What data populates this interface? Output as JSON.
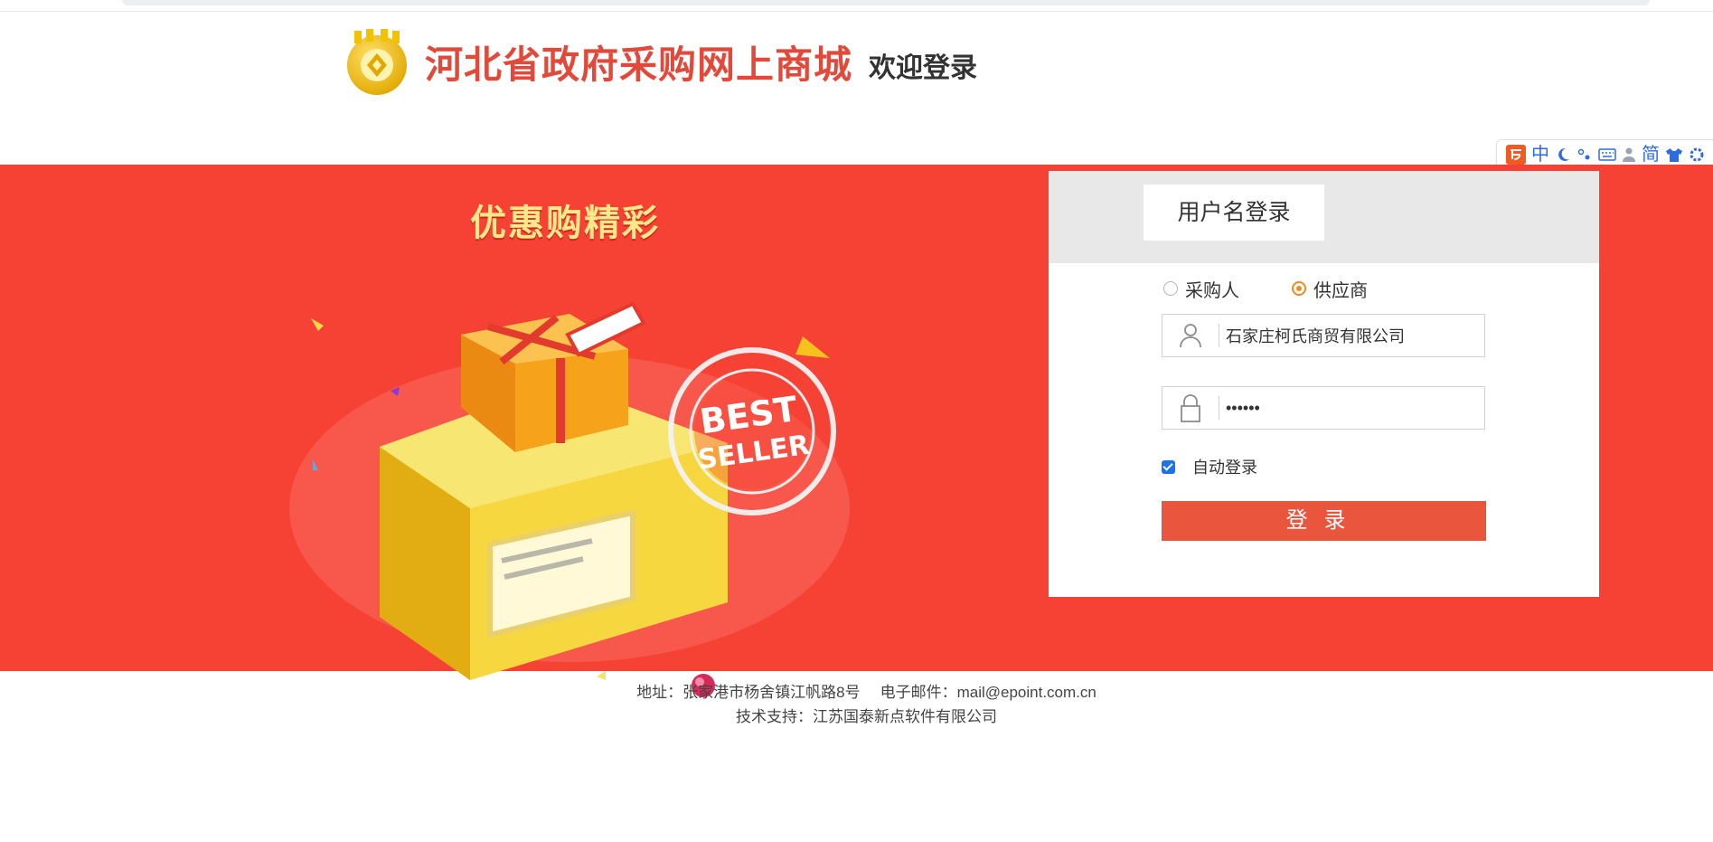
{
  "header": {
    "site_title": "河北省政府采购网上商城",
    "welcome": "欢迎登录"
  },
  "ime_toolbar": {
    "items": [
      "中",
      "简"
    ]
  },
  "banner": {
    "promo_title": "优惠购精彩",
    "stamp_text_main": "BEST",
    "stamp_text_sub": "SELLER",
    "stamp_ring_text": "BEST SELLER"
  },
  "login": {
    "tab_label": "用户名登录",
    "roles": [
      {
        "label": "采购人",
        "selected": false
      },
      {
        "label": "供应商",
        "selected": true
      }
    ],
    "username_value": "石家庄柯氏商贸有限公司",
    "password_value": "••••••",
    "auto_login_label": "自动登录",
    "auto_login_checked": true,
    "submit_label": "登录"
  },
  "footer": {
    "address": "地址：张家港市杨舍镇江帆路8号",
    "email": "电子邮件：mail@epoint.com.cn",
    "support": "技术支持：江苏国泰新点软件有限公司"
  },
  "colors": {
    "banner_red": "#f64235",
    "title_red": "#e14a3b",
    "button_red": "#e9553d",
    "radio_orange": "#f28a1e"
  }
}
